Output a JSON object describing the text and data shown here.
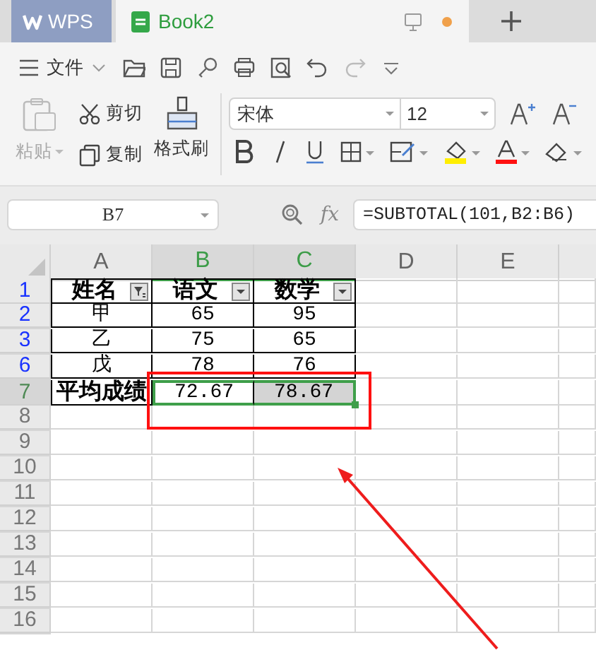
{
  "tabs": [
    {
      "kind": "app",
      "label": "WPS",
      "selected": false
    },
    {
      "kind": "doc",
      "label": "Book2",
      "selected": true,
      "modified": true
    }
  ],
  "menu": {
    "label": "文件"
  },
  "clipboard": [
    {
      "kind": "paste",
      "label": "粘贴",
      "disabled": true
    },
    {
      "kind": "cut",
      "label": "剪切",
      "disabled": false
    },
    {
      "kind": "copy",
      "label": "复制",
      "disabled": false
    },
    {
      "kind": "painter",
      "label": "格式刷",
      "disabled": false
    }
  ],
  "font": {
    "family": "宋体",
    "size": "12"
  },
  "name_box": "B7",
  "formula_label": "fx",
  "formula": "=SUBTOTAL(101,B2:B6)",
  "columns": [
    {
      "label": "A",
      "selected": false
    },
    {
      "label": "B",
      "selected": true
    },
    {
      "label": "C",
      "selected": true
    },
    {
      "label": "D",
      "selected": false
    },
    {
      "label": "E",
      "selected": false
    }
  ],
  "rows": [
    {
      "label": "1",
      "filtered": true,
      "selected": false,
      "cells": [
        {
          "kind": "filtered_header",
          "text": "姓名",
          "bold": true,
          "selected": false,
          "active": false
        },
        {
          "kind": "header",
          "text": "语文",
          "bold": true,
          "selected": false,
          "active": false
        },
        {
          "kind": "header",
          "text": "数学",
          "bold": true,
          "selected": false,
          "active": false
        }
      ]
    },
    {
      "label": "2",
      "filtered": true,
      "selected": false,
      "cells": [
        {
          "kind": "text",
          "text": "甲",
          "bold": false,
          "selected": false,
          "active": false
        },
        {
          "kind": "text",
          "text": "65",
          "bold": false,
          "selected": false,
          "active": false
        },
        {
          "kind": "text",
          "text": "95",
          "bold": false,
          "selected": false,
          "active": false
        }
      ]
    },
    {
      "label": "3",
      "filtered": true,
      "selected": false,
      "cells": [
        {
          "kind": "text",
          "text": "乙",
          "bold": false,
          "selected": false,
          "active": false
        },
        {
          "kind": "text",
          "text": "75",
          "bold": false,
          "selected": false,
          "active": false
        },
        {
          "kind": "text",
          "text": "65",
          "bold": false,
          "selected": false,
          "active": false
        }
      ]
    },
    {
      "label": "6",
      "filtered": true,
      "selected": false,
      "cells": [
        {
          "kind": "text",
          "text": "戊",
          "bold": false,
          "selected": false,
          "active": false
        },
        {
          "kind": "text",
          "text": "78",
          "bold": false,
          "selected": false,
          "active": false
        },
        {
          "kind": "text",
          "text": "76",
          "bold": false,
          "selected": false,
          "active": false
        }
      ]
    },
    {
      "label": "7",
      "filtered": false,
      "selected": true,
      "cells": [
        {
          "kind": "text",
          "text": "平均成绩",
          "bold": true,
          "selected": false,
          "active": false
        },
        {
          "kind": "text",
          "text": "72.67",
          "bold": false,
          "selected": true,
          "active": true
        },
        {
          "kind": "text",
          "text": "78.67",
          "bold": false,
          "selected": true,
          "active": false
        }
      ]
    },
    {
      "label": "8",
      "filtered": false,
      "selected": false
    },
    {
      "label": "9",
      "filtered": false,
      "selected": false
    },
    {
      "label": "10",
      "filtered": false,
      "selected": false
    },
    {
      "label": "11",
      "filtered": false,
      "selected": false
    },
    {
      "label": "12",
      "filtered": false,
      "selected": false
    },
    {
      "label": "13",
      "filtered": false,
      "selected": false
    },
    {
      "label": "14",
      "filtered": false,
      "selected": false
    },
    {
      "label": "15",
      "filtered": false,
      "selected": false
    },
    {
      "label": "16",
      "filtered": false,
      "selected": false
    }
  ]
}
